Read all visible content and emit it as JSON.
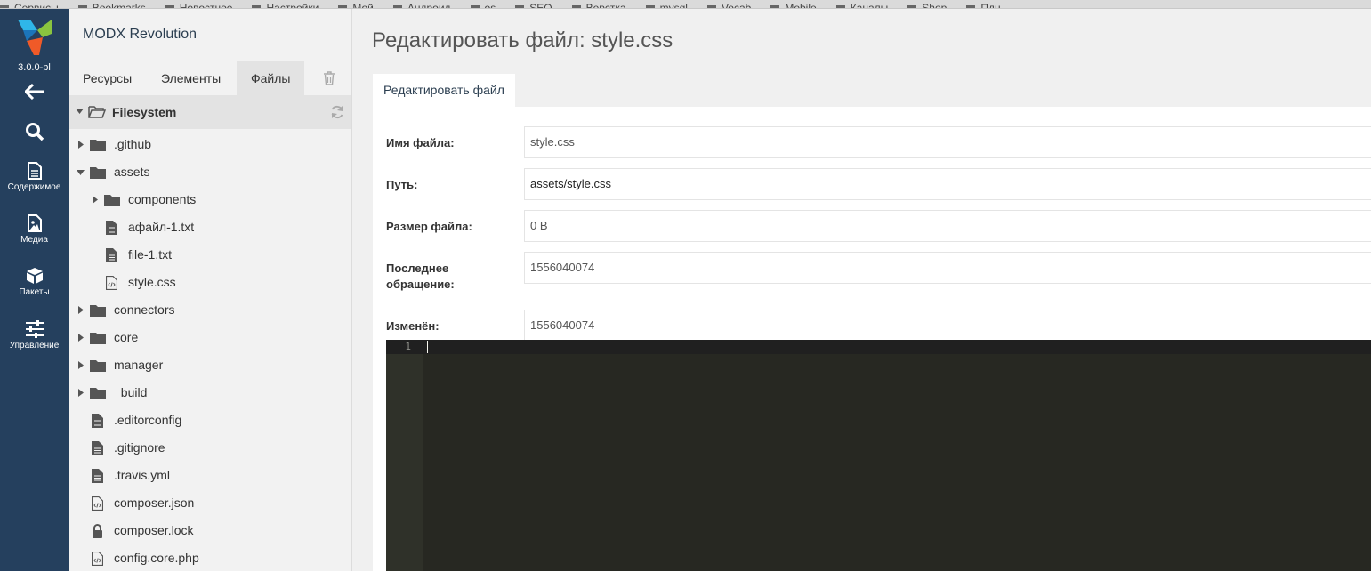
{
  "bookmarks": [
    "Сервисы",
    "Bookmarks",
    "Новостное",
    "Настройки",
    "Мой",
    "Андроид",
    "os",
    "SEO",
    "Верстка",
    "mysql",
    "Vocab",
    "Mobile",
    "Каналы",
    "Shop",
    "Пдн"
  ],
  "rail": {
    "version": "3.0.0-pl",
    "items": [
      {
        "name": "back",
        "label": ""
      },
      {
        "name": "search",
        "label": ""
      },
      {
        "name": "content",
        "label": "Содержимое"
      },
      {
        "name": "media",
        "label": "Медиа"
      },
      {
        "name": "packages",
        "label": "Пакеты"
      },
      {
        "name": "manage",
        "label": "Управление"
      }
    ]
  },
  "tree": {
    "site_name": "MODX Revolution",
    "tabs": [
      "Ресурсы",
      "Элементы",
      "Файлы"
    ],
    "active_tab": "Файлы",
    "root_label": "Filesystem",
    "nodes": [
      {
        "label": ".github",
        "type": "folder",
        "depth": 0,
        "expanded": false
      },
      {
        "label": "assets",
        "type": "folder",
        "depth": 0,
        "expanded": true
      },
      {
        "label": "components",
        "type": "folder",
        "depth": 1,
        "expanded": false
      },
      {
        "label": "афайл-1.txt",
        "type": "file",
        "depth": 1
      },
      {
        "label": "file-1.txt",
        "type": "file",
        "depth": 1
      },
      {
        "label": "style.css",
        "type": "code",
        "depth": 1
      },
      {
        "label": "connectors",
        "type": "folder",
        "depth": 0,
        "expanded": false
      },
      {
        "label": "core",
        "type": "folder",
        "depth": 0,
        "expanded": false
      },
      {
        "label": "manager",
        "type": "folder",
        "depth": 0,
        "expanded": false
      },
      {
        "label": "_build",
        "type": "folder",
        "depth": 0,
        "expanded": false
      },
      {
        "label": ".editorconfig",
        "type": "file",
        "depth": 0
      },
      {
        "label": ".gitignore",
        "type": "file",
        "depth": 0
      },
      {
        "label": ".travis.yml",
        "type": "file",
        "depth": 0
      },
      {
        "label": "composer.json",
        "type": "code",
        "depth": 0
      },
      {
        "label": "composer.lock",
        "type": "lock",
        "depth": 0
      },
      {
        "label": "config.core.php",
        "type": "code",
        "depth": 0
      }
    ]
  },
  "main": {
    "title": "Редактировать файл: style.css",
    "tab_label": "Редактировать файл",
    "fields": [
      {
        "label": "Имя файла:",
        "value": "style.css"
      },
      {
        "label": "Путь:",
        "value": "assets/style.css"
      },
      {
        "label": "Размер файла:",
        "value": "0 B"
      },
      {
        "label": "Последнее обращение:",
        "value": "1556040074"
      },
      {
        "label": "Изменён:",
        "value": "1556040074"
      }
    ],
    "editor": {
      "line_number": "1"
    }
  },
  "colors": {
    "rail_bg": "#25405e",
    "tree_bg": "#f2f2f2",
    "editor_bg": "#272822",
    "accent": "#2b3e50"
  }
}
